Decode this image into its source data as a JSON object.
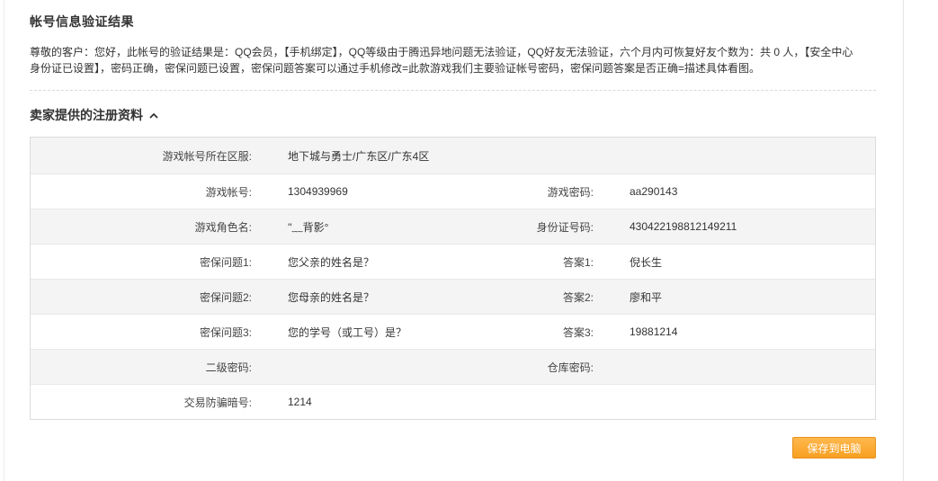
{
  "header": {
    "title": "帐号信息验证结果",
    "notice_line1": "尊敬的客户：您好，此帐号的验证结果是：QQ会员，【手机绑定】，QQ等级由于腾迅异地问题无法验证，QQ好友无法验证，六个月内可恢复好友个数为：共 0 人，【安全中心",
    "notice_line2": "身份证已设置】，密码正确，密保问题已设置，密保问题答案可以通过手机修改=此款游戏我们主要验证帐号密码，密保问题答案是否正确=描述具体看图。"
  },
  "section": {
    "title": "卖家提供的注册资料",
    "toggle_icon": "chevron-up-icon"
  },
  "table": {
    "server_label": "游戏帐号所在区服:",
    "server_value": "地下城与勇士/广东区/广东4区",
    "account_label": "游戏帐号:",
    "account_value": "1304939969",
    "password_label": "游戏密码:",
    "password_value": "aa290143",
    "role_label": "游戏角色名:",
    "role_value": "''﹏背影°",
    "id_label": "身份证号码:",
    "id_value": "430422198812149211",
    "q1_label": "密保问题1:",
    "q1_value": "您父亲的姓名是？",
    "a1_label": "答案1:",
    "a1_value": "倪长生",
    "q2_label": "密保问题2:",
    "q2_value": "您母亲的姓名是？",
    "a2_label": "答案2:",
    "a2_value": "廖和平",
    "q3_label": "密保问题3:",
    "q3_value": "您的学号（或工号）是？",
    "a3_label": "答案3:",
    "a3_value": "19881214",
    "second_pw_label": "二级密码:",
    "second_pw_value": "",
    "storage_pw_label": "仓库密码:",
    "storage_pw_value": "",
    "anti_fraud_label": "交易防骗暗号:",
    "anti_fraud_value": "1214"
  },
  "actions": {
    "save_label": "保存到电脑"
  },
  "colors": {
    "accent": "#f7a021",
    "row_alt": "#f4f4f4",
    "border": "#dcdcdc"
  }
}
